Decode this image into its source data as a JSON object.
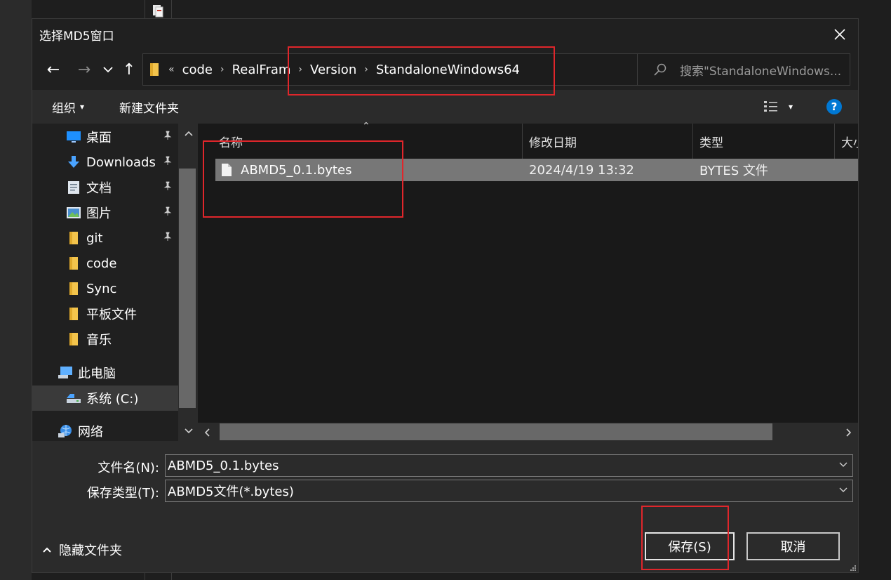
{
  "dialog": {
    "title": "选择MD5窗口",
    "close_glyph": "✕"
  },
  "nav": {
    "back_glyph": "←",
    "forward_glyph": "→",
    "recent_glyph": "⌄",
    "up_glyph": "↑"
  },
  "address": {
    "overflow_glyph": "«",
    "separator_glyph": "›",
    "crumbs": [
      "code",
      "RealFram",
      "Version",
      "StandaloneWindows64"
    ],
    "dropdown_glyph": "⌄",
    "refresh_glyph": "↻"
  },
  "search": {
    "placeholder": "搜索\"StandaloneWindows..."
  },
  "toolbar": {
    "organize_label": "组织",
    "organize_arrow": "▾",
    "new_folder_label": "新建文件夹",
    "view_arrow": "▾",
    "help_glyph": "?"
  },
  "sidebar": {
    "items": [
      {
        "label": "桌面",
        "icon": "desktop-icon",
        "pinned": true
      },
      {
        "label": "Downloads",
        "icon": "download-icon",
        "pinned": true
      },
      {
        "label": "文档",
        "icon": "document-icon",
        "pinned": true
      },
      {
        "label": "图片",
        "icon": "picture-icon",
        "pinned": true
      },
      {
        "label": "git",
        "icon": "folder-icon",
        "pinned": true
      },
      {
        "label": "code",
        "icon": "folder-icon",
        "pinned": false
      },
      {
        "label": "Sync",
        "icon": "folder-icon",
        "pinned": false
      },
      {
        "label": "平板文件",
        "icon": "folder-icon",
        "pinned": false
      },
      {
        "label": "音乐",
        "icon": "folder-icon",
        "pinned": false
      },
      {
        "label": "此电脑",
        "icon": "computer-icon",
        "pinned": false
      },
      {
        "label": "系统 (C:)",
        "icon": "drive-icon",
        "pinned": false,
        "selected": true
      },
      {
        "label": "网络",
        "icon": "network-icon",
        "pinned": false
      }
    ],
    "pin_glyph": "📌",
    "scroll_up_glyph": "⌃",
    "scroll_down_glyph": "⌄"
  },
  "files": {
    "sort_glyph": "⌃",
    "columns": [
      "名称",
      "修改日期",
      "类型",
      "大小"
    ],
    "rows": [
      {
        "name": "ABMD5_0.1.bytes",
        "modified": "2024/4/19 13:32",
        "type": "BYTES 文件"
      }
    ],
    "scroll_left_glyph": "‹",
    "scroll_right_glyph": "›"
  },
  "form": {
    "filename_label": "文件名(N):",
    "filename_value": "ABMD5_0.1.bytes",
    "filetype_label": "保存类型(T):",
    "filetype_value": "ABMD5文件(*.bytes)",
    "dropdown_glyph": "⌄"
  },
  "footer": {
    "hide_folders_glyph": "⌃",
    "hide_folders_label": "隐藏文件夹",
    "save_label": "保存(S)",
    "cancel_label": "取消"
  },
  "colors": {
    "accent": "#0078d4",
    "annotation": "#e0262b",
    "selected_row": "#777777",
    "folder_yellow": "#f3c44c"
  }
}
